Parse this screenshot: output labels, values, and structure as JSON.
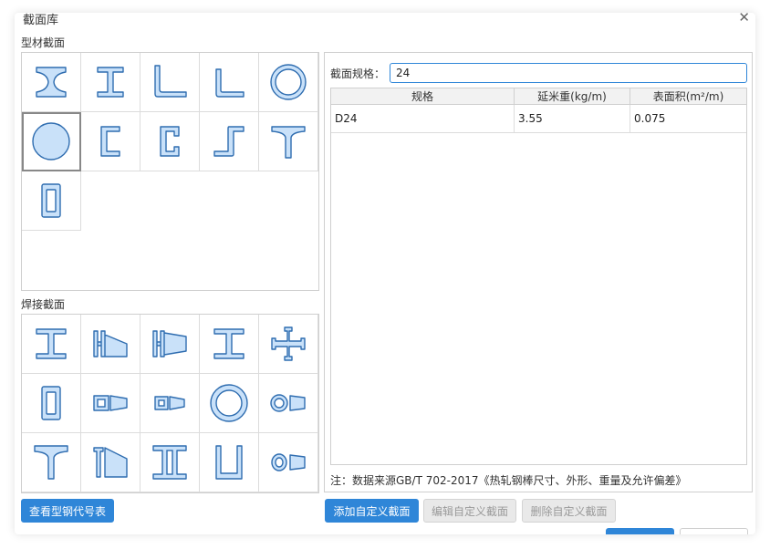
{
  "dialog": {
    "title": "截面库",
    "close_icon": "close-icon"
  },
  "profile_section": {
    "label": "型材截面",
    "items": [
      {
        "icon": "i-beam-icon"
      },
      {
        "icon": "h-beam-icon"
      },
      {
        "icon": "unequal-angle-icon"
      },
      {
        "icon": "equal-angle-icon"
      },
      {
        "icon": "pipe-icon"
      },
      {
        "icon": "round-bar-icon",
        "selected": true
      },
      {
        "icon": "channel-icon"
      },
      {
        "icon": "lipped-channel-icon"
      },
      {
        "icon": "z-section-icon"
      },
      {
        "icon": "t-section-icon"
      },
      {
        "icon": "rectangular-tube-icon"
      }
    ]
  },
  "welded_section": {
    "label": "焊接截面",
    "items": [
      {
        "icon": "welded-h-icon"
      },
      {
        "icon": "tapered-h-icon"
      },
      {
        "icon": "tapered-h-horizontal-icon"
      },
      {
        "icon": "welded-i-icon"
      },
      {
        "icon": "cross-h-icon"
      },
      {
        "icon": "welded-box-icon"
      },
      {
        "icon": "tapered-box-icon"
      },
      {
        "icon": "tapered-box-small-icon"
      },
      {
        "icon": "welded-pipe-icon"
      },
      {
        "icon": "tapered-pipe-icon"
      },
      {
        "icon": "welded-t-icon"
      },
      {
        "icon": "tapered-t-icon"
      },
      {
        "icon": "double-i-icon"
      },
      {
        "icon": "u-section-icon"
      },
      {
        "icon": "tapered-pipe-small-icon"
      }
    ]
  },
  "spec": {
    "label": "截面规格：",
    "value": "24"
  },
  "table": {
    "headers": [
      "规格",
      "延米重(kg/m)",
      "表面积(m²/m)"
    ],
    "rows": [
      [
        "D24",
        "3.55",
        "0.075"
      ]
    ]
  },
  "note": "注：数据来源GB/T 702-2017《热轧钢棒尺寸、外形、重量及允许偏差》",
  "buttons": {
    "view_codes": "查看型钢代号表",
    "add_custom": "添加自定义截面",
    "edit_custom": "编辑自定义截面",
    "delete_custom": "删除自定义截面"
  },
  "colors": {
    "accent": "#2f86d8",
    "shape_fill": "#c9e1f9",
    "shape_stroke": "#2f6db0"
  }
}
